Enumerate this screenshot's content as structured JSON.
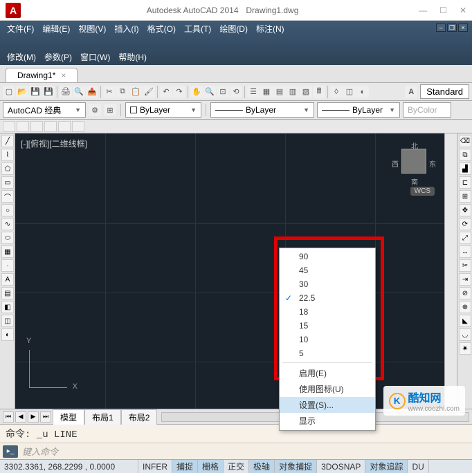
{
  "title_bar": {
    "app_name": "Autodesk AutoCAD 2014",
    "doc_name": "Drawing1.dwg"
  },
  "menus_row1": [
    "文件(F)",
    "编辑(E)",
    "视图(V)",
    "插入(I)",
    "格式(O)",
    "工具(T)",
    "绘图(D)",
    "标注(N)"
  ],
  "menus_row2": [
    "修改(M)",
    "参数(P)",
    "窗口(W)",
    "帮助(H)"
  ],
  "doc_tab": {
    "label": "Drawing1*"
  },
  "icons_row1": [
    "new",
    "open",
    "save",
    "saveas",
    "print",
    "preview",
    "publish",
    "cut",
    "copy",
    "paste",
    "match",
    "undo",
    "redo",
    "pan",
    "zoom-real",
    "zoom-win",
    "zoom-ext",
    "zoom-prev",
    "props",
    "sheet",
    "tool",
    "calc",
    "layer-pal",
    "render"
  ],
  "standard_label": "Standard",
  "workspace_combo": "AutoCAD 经典",
  "layer_combo": "ByLayer",
  "color_combo": "ByLayer",
  "ltype_combo": "ByLayer",
  "lweight_combo": "ByColor",
  "canvas_label": "[-][俯视][二维线框]",
  "viewcube": {
    "n": "北",
    "s": "南",
    "e": "东",
    "w": "西",
    "wcs": "WCS"
  },
  "axis": {
    "x": "X",
    "y": "Y"
  },
  "layout_tabs": {
    "model": "模型",
    "l1": "布局1",
    "l2": "布局2"
  },
  "cmd_history": "命令: _u LINE",
  "cmd_placeholder": "键入命令",
  "status": {
    "coords": "3302.3361,  268.2299 , 0.0000",
    "items": [
      "INFER",
      "捕捉",
      "栅格",
      "正交",
      "极轴",
      "对象捕捉",
      "3DOSNAP",
      "对象追踪",
      "DU"
    ]
  },
  "context_menu": {
    "angles": [
      "90",
      "45",
      "30",
      "22.5",
      "18",
      "15",
      "10",
      "5"
    ],
    "checked_index": 3,
    "enable": "启用(E)",
    "use_icon": "使用图标(U)",
    "settings": "设置(S)...",
    "display": "显示"
  },
  "watermark": {
    "logo": "K",
    "name": "酷知网",
    "url": "www.coozhi.com"
  }
}
